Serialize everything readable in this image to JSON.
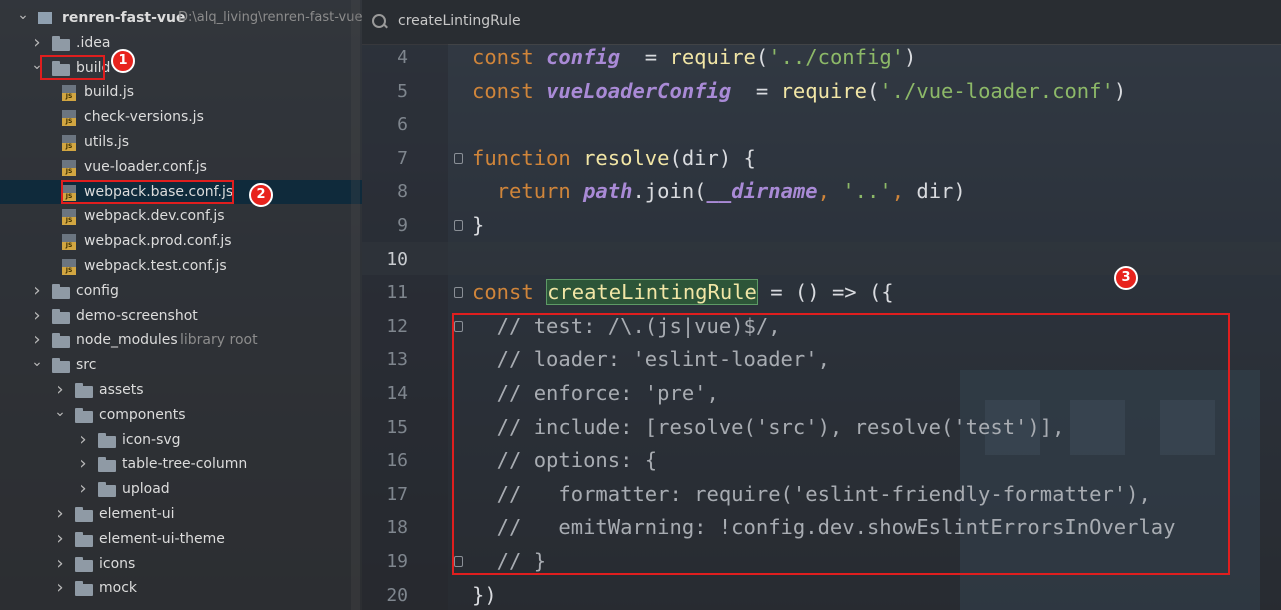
{
  "project": {
    "root_name": "renren-fast-vue",
    "root_path": "D:\\alq_living\\renren-fast-vue",
    "items": [
      {
        "label": "renren-fast-vue",
        "kind": "module",
        "depth": 0,
        "expanded": true
      },
      {
        "label": ".idea",
        "kind": "folder",
        "depth": 1,
        "expanded": false
      },
      {
        "label": "build",
        "kind": "folder",
        "depth": 1,
        "expanded": true
      },
      {
        "label": "build.js",
        "kind": "js",
        "depth": 2
      },
      {
        "label": "check-versions.js",
        "kind": "js",
        "depth": 2
      },
      {
        "label": "utils.js",
        "kind": "js",
        "depth": 2
      },
      {
        "label": "vue-loader.conf.js",
        "kind": "js",
        "depth": 2
      },
      {
        "label": "webpack.base.conf.js",
        "kind": "js",
        "depth": 2,
        "selected": true
      },
      {
        "label": "webpack.dev.conf.js",
        "kind": "js",
        "depth": 2
      },
      {
        "label": "webpack.prod.conf.js",
        "kind": "js",
        "depth": 2
      },
      {
        "label": "webpack.test.conf.js",
        "kind": "js",
        "depth": 2
      },
      {
        "label": "config",
        "kind": "folder",
        "depth": 1,
        "expanded": false
      },
      {
        "label": "demo-screenshot",
        "kind": "folder",
        "depth": 1,
        "expanded": false
      },
      {
        "label": "node_modules",
        "kind": "folder",
        "depth": 1,
        "expanded": false,
        "suffix": "library root"
      },
      {
        "label": "src",
        "kind": "folder",
        "depth": 1,
        "expanded": true
      },
      {
        "label": "assets",
        "kind": "folder",
        "depth": 2,
        "expanded": false
      },
      {
        "label": "components",
        "kind": "folder",
        "depth": 2,
        "expanded": true
      },
      {
        "label": "icon-svg",
        "kind": "folder",
        "depth": 3,
        "expanded": false
      },
      {
        "label": "table-tree-column",
        "kind": "folder",
        "depth": 3,
        "expanded": false
      },
      {
        "label": "upload",
        "kind": "folder",
        "depth": 3,
        "expanded": false
      },
      {
        "label": "element-ui",
        "kind": "folder",
        "depth": 2,
        "expanded": false
      },
      {
        "label": "element-ui-theme",
        "kind": "folder",
        "depth": 2,
        "expanded": false
      },
      {
        "label": "icons",
        "kind": "folder",
        "depth": 2,
        "expanded": false
      },
      {
        "label": "mock",
        "kind": "folder",
        "depth": 2,
        "expanded": false
      }
    ]
  },
  "annotations": {
    "badge1": "1",
    "badge2": "2",
    "badge3": "3"
  },
  "editor": {
    "breadcrumb": "createLintingRule",
    "current_line": 10,
    "lines": [
      {
        "n": "4",
        "tokens": [
          [
            "kw",
            "const "
          ],
          [
            "glob",
            "config"
          ],
          [
            "",
            "  = "
          ],
          [
            "fn",
            "require"
          ],
          [
            "",
            "("
          ],
          [
            "str",
            "'../config'"
          ],
          [
            "",
            ")"
          ]
        ]
      },
      {
        "n": "5",
        "tokens": [
          [
            "kw",
            "const "
          ],
          [
            "glob",
            "vueLoaderConfig"
          ],
          [
            "",
            "  = "
          ],
          [
            "fn",
            "require"
          ],
          [
            "",
            "("
          ],
          [
            "str",
            "'./vue-loader.conf'"
          ],
          [
            "",
            ")"
          ]
        ]
      },
      {
        "n": "6",
        "tokens": []
      },
      {
        "n": "7",
        "tokens": [
          [
            "kw",
            "function "
          ],
          [
            "fn",
            "resolve"
          ],
          [
            "",
            "(dir) {"
          ]
        ],
        "fold": true
      },
      {
        "n": "8",
        "tokens": [
          [
            "",
            "  "
          ],
          [
            "kw",
            "return "
          ],
          [
            "glob",
            "path"
          ],
          [
            "",
            ".join("
          ],
          [
            "glob",
            "__dirname"
          ],
          [
            "kw",
            ", "
          ],
          [
            "str",
            "'..'"
          ],
          [
            "kw",
            ", "
          ],
          [
            "",
            "dir)"
          ]
        ]
      },
      {
        "n": "9",
        "tokens": [
          [
            "",
            "}"
          ]
        ],
        "fold": true
      },
      {
        "n": "10",
        "tokens": []
      },
      {
        "n": "11",
        "tokens": [
          [
            "kw",
            "const "
          ],
          [
            "hl",
            "createLintingRule"
          ],
          [
            "",
            " = () => ({"
          ]
        ],
        "fold": true
      },
      {
        "n": "12",
        "tokens": [
          [
            "cmt",
            "  // test: /\\.(js|vue)$/,"
          ]
        ],
        "fold": true
      },
      {
        "n": "13",
        "tokens": [
          [
            "cmt",
            "  // loader: 'eslint-loader',"
          ]
        ]
      },
      {
        "n": "14",
        "tokens": [
          [
            "cmt",
            "  // enforce: 'pre',"
          ]
        ]
      },
      {
        "n": "15",
        "tokens": [
          [
            "cmt",
            "  // include: [resolve('src'), resolve('test')],"
          ]
        ]
      },
      {
        "n": "16",
        "tokens": [
          [
            "cmt",
            "  // options: {"
          ]
        ]
      },
      {
        "n": "17",
        "tokens": [
          [
            "cmt",
            "  //   formatter: require('eslint-friendly-formatter'),"
          ]
        ]
      },
      {
        "n": "18",
        "tokens": [
          [
            "cmt",
            "  //   emitWarning: !config.dev.showEslintErrorsInOverlay"
          ]
        ]
      },
      {
        "n": "19",
        "tokens": [
          [
            "cmt",
            "  // }"
          ]
        ],
        "fold": true
      },
      {
        "n": "20",
        "tokens": [
          [
            "",
            "})"
          ]
        ]
      }
    ]
  }
}
